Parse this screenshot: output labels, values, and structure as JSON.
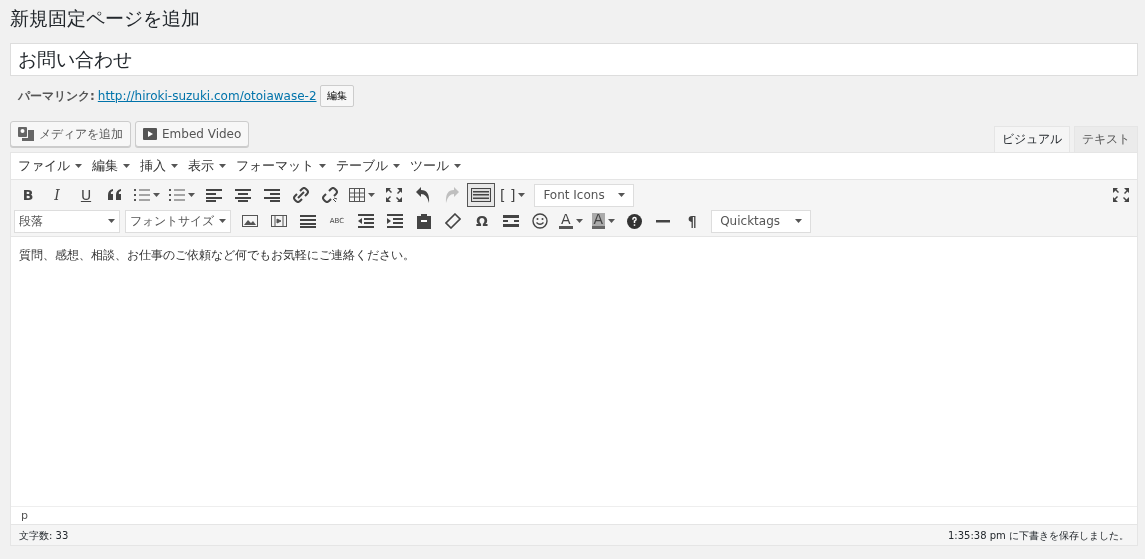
{
  "heading": "新規固定ページを追加",
  "title_field": {
    "value": "お問い合わせ"
  },
  "permalink": {
    "label": "パーマリンク:",
    "url": "http://hiroki-suzuki.com/otoiawase-2",
    "edit_button": "編集"
  },
  "media_buttons": [
    {
      "kind": "media",
      "label": "メディアを追加"
    },
    {
      "kind": "video",
      "label": "Embed Video"
    }
  ],
  "editor_tabs": [
    {
      "label": "ビジュアル",
      "selected": true
    },
    {
      "label": "テキスト",
      "selected": false
    }
  ],
  "menubar": [
    "ファイル",
    "編集",
    "挿入",
    "表示",
    "フォーマット",
    "テーブル",
    "ツール"
  ],
  "toolbar_rows": [
    [
      {
        "kind": "bold",
        "label": "B",
        "on": false,
        "disabled": false
      },
      {
        "kind": "italic",
        "label": "I",
        "on": false,
        "disabled": false
      },
      {
        "kind": "underline",
        "label": "U",
        "on": false,
        "disabled": false
      },
      {
        "kind": "quote",
        "on": false,
        "disabled": false
      },
      {
        "kind": "bullets",
        "dropdown": true,
        "on": false,
        "disabled": false
      },
      {
        "kind": "numbers",
        "dropdown": true,
        "on": false,
        "disabled": false
      },
      {
        "kind": "align-left",
        "on": false,
        "disabled": false
      },
      {
        "kind": "align-center",
        "on": false,
        "disabled": false
      },
      {
        "kind": "align-right",
        "on": false,
        "disabled": false
      },
      {
        "kind": "link",
        "on": false,
        "disabled": false
      },
      {
        "kind": "unlink",
        "on": false,
        "disabled": false
      },
      {
        "kind": "table",
        "dropdown": true,
        "on": false,
        "disabled": false
      },
      {
        "kind": "fullscreen",
        "on": false,
        "disabled": false
      },
      {
        "kind": "undo",
        "on": false,
        "disabled": false
      },
      {
        "kind": "redo",
        "on": false,
        "disabled": true
      },
      {
        "kind": "keyboard",
        "on": true,
        "disabled": false
      },
      {
        "kind": "char",
        "label": "[ ]",
        "dropdown": true,
        "on": false,
        "disabled": false
      },
      {
        "kind": "select",
        "label": "Font Icons",
        "on": false,
        "disabled": false
      }
    ],
    [
      {
        "kind": "select",
        "label": "段落",
        "on": false,
        "disabled": false
      },
      {
        "kind": "select",
        "label": "フォントサイズ",
        "on": false,
        "disabled": false
      },
      {
        "kind": "image",
        "on": false,
        "disabled": false
      },
      {
        "kind": "film",
        "on": false,
        "disabled": false
      },
      {
        "kind": "justify",
        "on": false,
        "disabled": false
      },
      {
        "kind": "abc",
        "label": "ABC",
        "on": false,
        "disabled": false
      },
      {
        "kind": "outdent",
        "on": false,
        "disabled": false
      },
      {
        "kind": "indent",
        "on": false,
        "disabled": false
      },
      {
        "kind": "clipboard",
        "on": false,
        "disabled": false
      },
      {
        "kind": "eraser",
        "on": false,
        "disabled": false
      },
      {
        "kind": "bold",
        "label": "Ω",
        "on": false,
        "disabled": false
      },
      {
        "kind": "more",
        "on": false,
        "disabled": false
      },
      {
        "kind": "smiley",
        "on": false,
        "disabled": false
      },
      {
        "kind": "text-color",
        "label": "A",
        "dropdown": true,
        "on": false,
        "disabled": false
      },
      {
        "kind": "background-color",
        "label": "A",
        "dropdown": true,
        "on": false,
        "disabled": false
      },
      {
        "kind": "help",
        "on": false,
        "disabled": false
      },
      {
        "kind": "hr",
        "on": false,
        "disabled": false
      },
      {
        "kind": "bold",
        "label": "¶",
        "on": false,
        "disabled": false
      },
      {
        "kind": "select",
        "label": "Quicktags",
        "on": false,
        "disabled": false
      }
    ]
  ],
  "content": "質問、感想、相談、お仕事のご依頼など何でもお気軽にご連絡ください。",
  "path": "p",
  "status_bar": {
    "word_count": "文字数: 33",
    "saved": "1:35:38 pm に下書きを保存しました。"
  }
}
